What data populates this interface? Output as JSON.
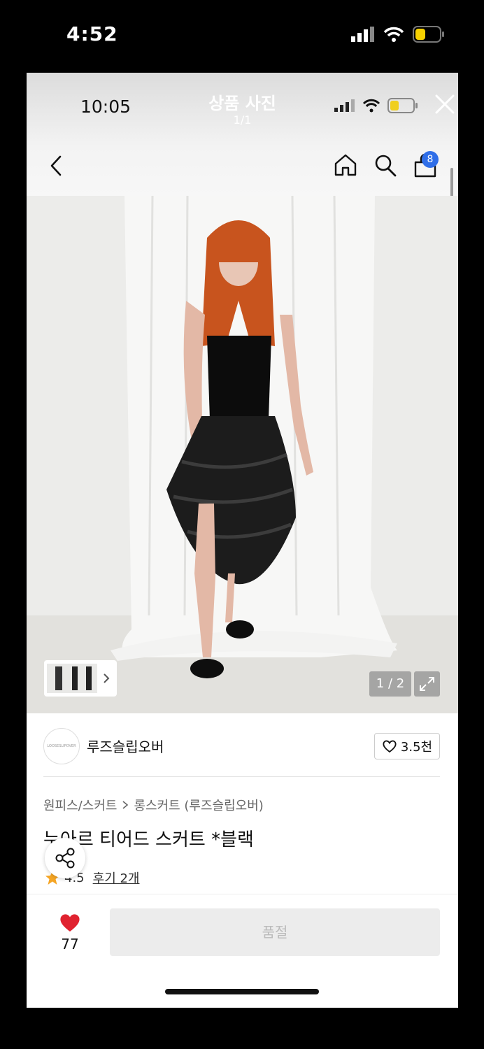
{
  "outer_status": {
    "time": "4:52"
  },
  "inner_status": {
    "time": "10:05"
  },
  "viewer": {
    "title": "상품 사진",
    "count": "1/1"
  },
  "header": {
    "cart_badge": "8"
  },
  "photo": {
    "page_indicator": "1 / 2"
  },
  "brand": {
    "name": "루즈슬립오버",
    "logo_text": "LOOSESLIPOVER",
    "likes": "3.5천"
  },
  "breadcrumb": {
    "category": "원피스/스커트",
    "subcategory": "롱스커트 (루즈슬립오버)"
  },
  "product": {
    "title": "누아르 티어드 스커트 *블랙",
    "rating": "4.5",
    "reviews": "후기 2개"
  },
  "bottom": {
    "wish_count": "77",
    "buy_label": "품절"
  },
  "colors": {
    "accent_blue": "#2f6ee8",
    "heart_red": "#e0222f",
    "star": "#f5a524"
  }
}
